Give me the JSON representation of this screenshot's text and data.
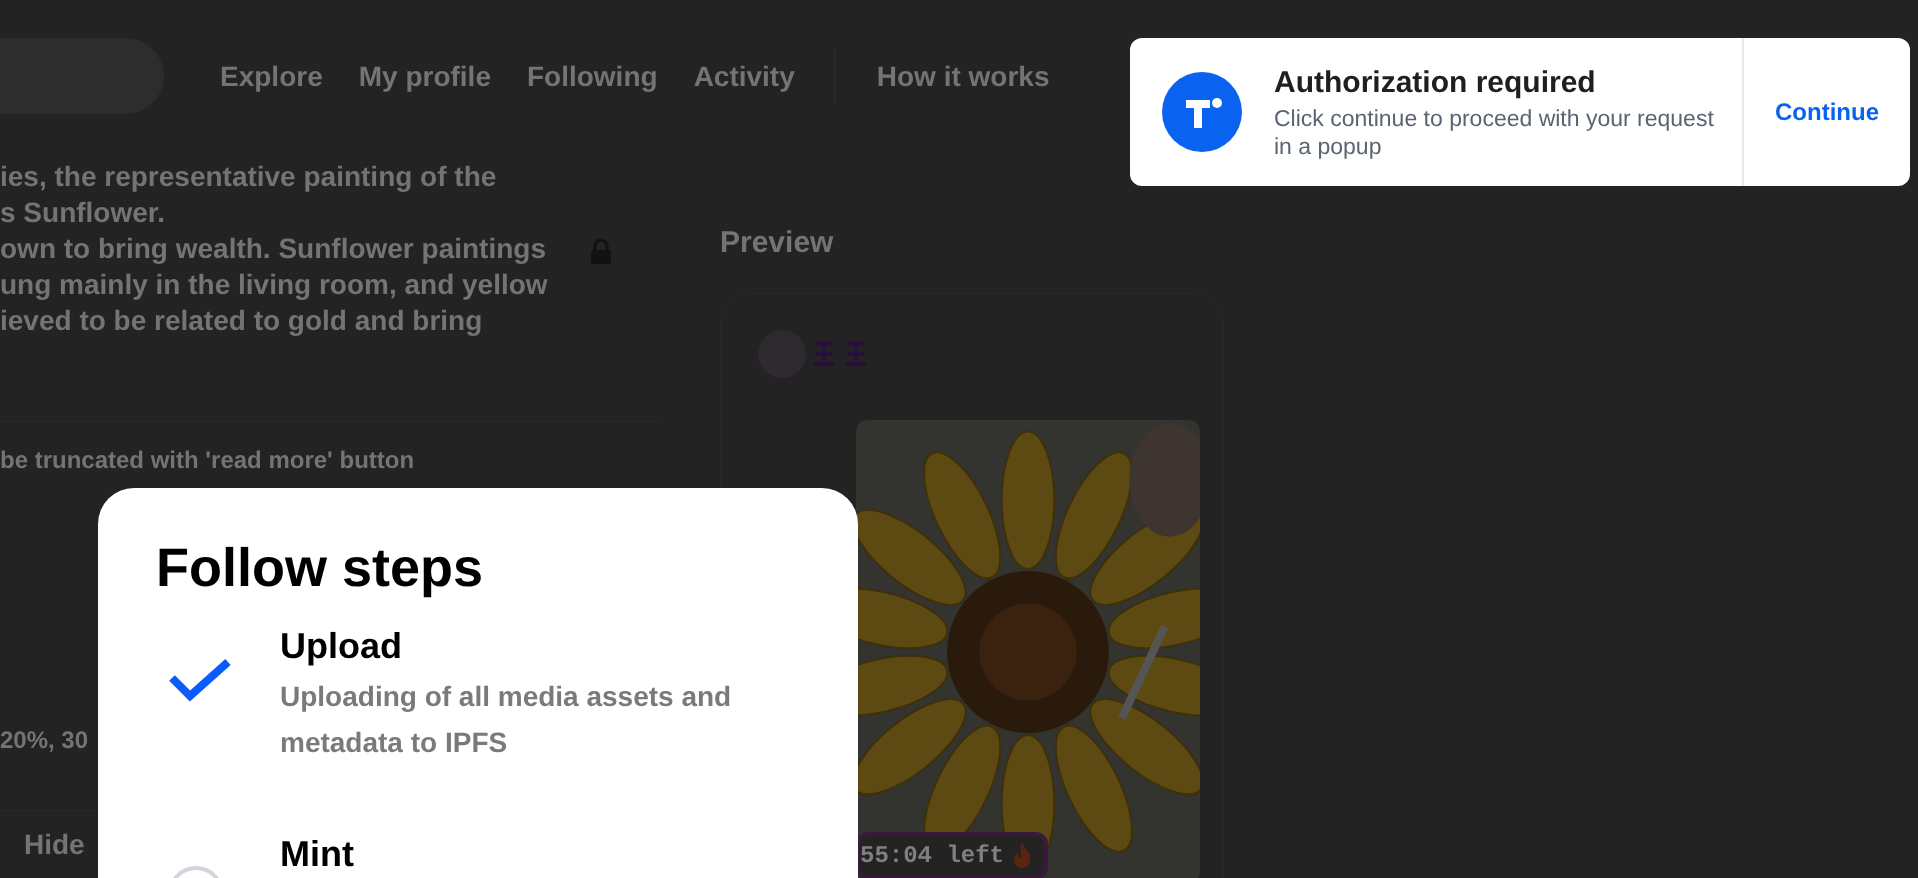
{
  "nav": {
    "links": [
      "Explore",
      "My profile",
      "Following",
      "Activity",
      "How it works"
    ]
  },
  "description": {
    "lines": [
      "ies, the representative painting of the",
      "s Sunflower.",
      "own to bring wealth. Sunflower paintings",
      "ung mainly in the living room, and yellow",
      "ieved to be related to gold and bring"
    ]
  },
  "note": "be truncated with 'read more' button",
  "royalties": "20%, 30",
  "hide_button": "Hide",
  "preview": {
    "title": "Preview",
    "timer": "55:04 left"
  },
  "dialog": {
    "title": "Follow steps",
    "steps": [
      {
        "title": "Upload",
        "description": "Uploading of all media assets and metadata to IPFS",
        "completed": true
      },
      {
        "title": "Mint",
        "completed": false
      }
    ]
  },
  "toast": {
    "title": "Authorization required",
    "message": "Click continue to proceed with your request in a popup",
    "action": "Continue"
  }
}
